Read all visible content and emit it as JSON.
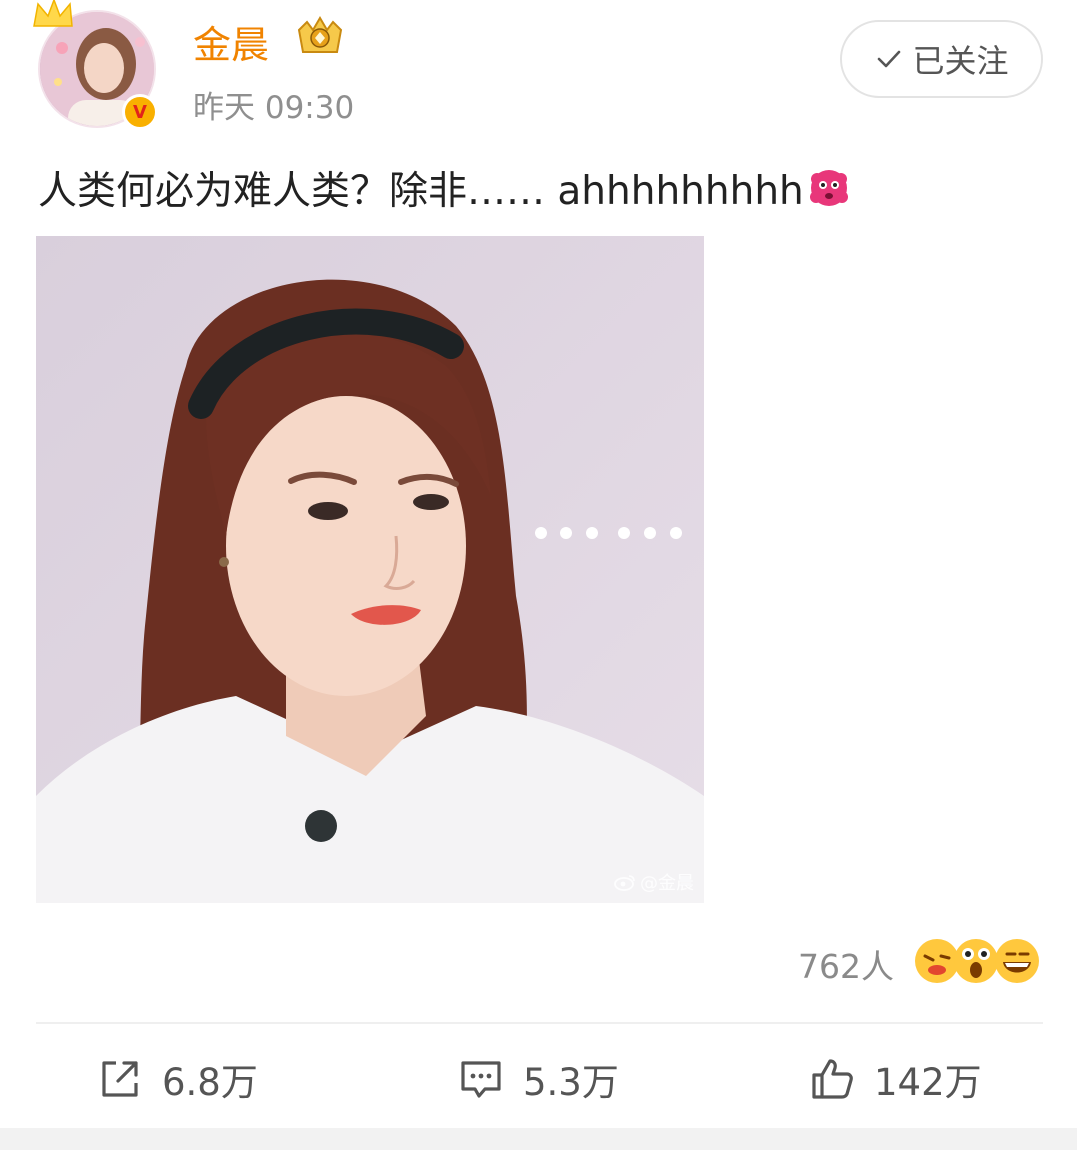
{
  "header": {
    "username": "金晨",
    "post_time": "昨天 09:30",
    "follow_label": "已关注",
    "verified_mark": "V"
  },
  "post": {
    "text": "人类何必为难人类？除非…… ahhhhhhhhh",
    "inline_emoji": "pink-fluff-emoji",
    "image": {
      "watermark": "@金晨"
    }
  },
  "reactions": {
    "count_label": "762人",
    "faces": [
      "kiss-face-emoji",
      "surprised-face-emoji",
      "grin-face-emoji"
    ]
  },
  "actions": {
    "repost": "6.8万",
    "comment": "5.3万",
    "like": "142万"
  },
  "colors": {
    "username": "#f08300",
    "secondary_text": "#8f8f8f",
    "verified_badge": "#f9b000"
  }
}
